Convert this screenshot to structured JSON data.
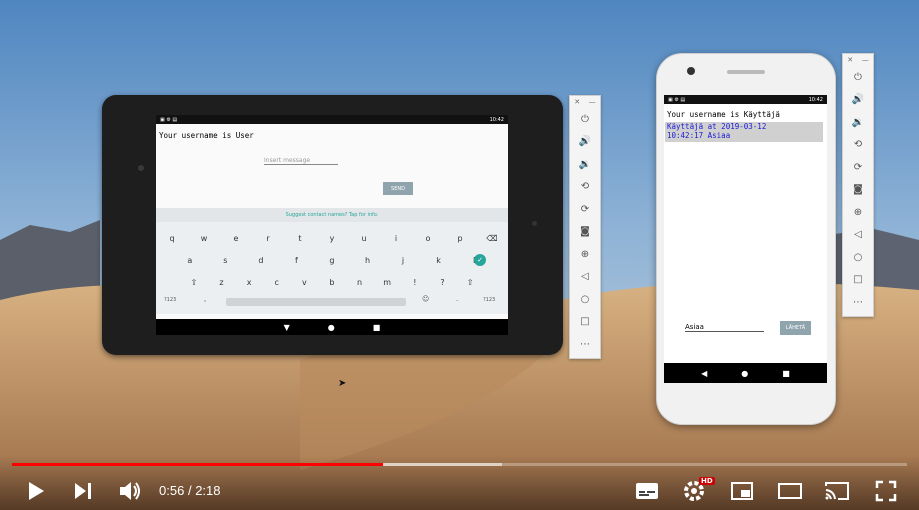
{
  "tablet": {
    "status_time": "10:42",
    "username_text": "Your username is User",
    "message_placeholder": "Insert message",
    "send_label": "SEND",
    "suggest_text": "Suggest contact names? Tap for info.",
    "keyboard_row1": [
      "q",
      "w",
      "e",
      "r",
      "t",
      "y",
      "u",
      "i",
      "o",
      "p"
    ],
    "keyboard_row2": [
      "a",
      "s",
      "d",
      "f",
      "g",
      "h",
      "j",
      "k",
      "l"
    ],
    "keyboard_row3": [
      "z",
      "x",
      "c",
      "v",
      "b",
      "n",
      "m",
      "!",
      "?"
    ],
    "keyboard_sym": "?123",
    "keyboard_comma": ",",
    "keyboard_period": "."
  },
  "phone": {
    "status_time": "10:42",
    "username_text": "Your username is Käyttäjä",
    "message_line1": "Käyttäjä at 2019-03-12",
    "message_line2": "10:42:17 Asiaa",
    "input_value": "Asiaa",
    "send_label": "LÄHETÄ"
  },
  "player": {
    "time_current": "0:56",
    "time_separator": "/",
    "time_total": "2:18",
    "progress_fraction": 0.415,
    "buffered_fraction": 0.548,
    "progress_color": "#ff0000",
    "hd_badge": "HD"
  },
  "icons": [
    "play-icon",
    "next-icon",
    "volume-icon",
    "subtitles-icon",
    "settings-icon",
    "miniplayer-icon",
    "theater-icon",
    "cast-icon",
    "fullscreen-icon",
    "power-icon",
    "volume-up-icon",
    "volume-down-icon",
    "rotate-left-icon",
    "rotate-right-icon",
    "camera-icon",
    "zoom-icon",
    "back-icon",
    "home-icon",
    "overview-icon",
    "more-icon"
  ]
}
